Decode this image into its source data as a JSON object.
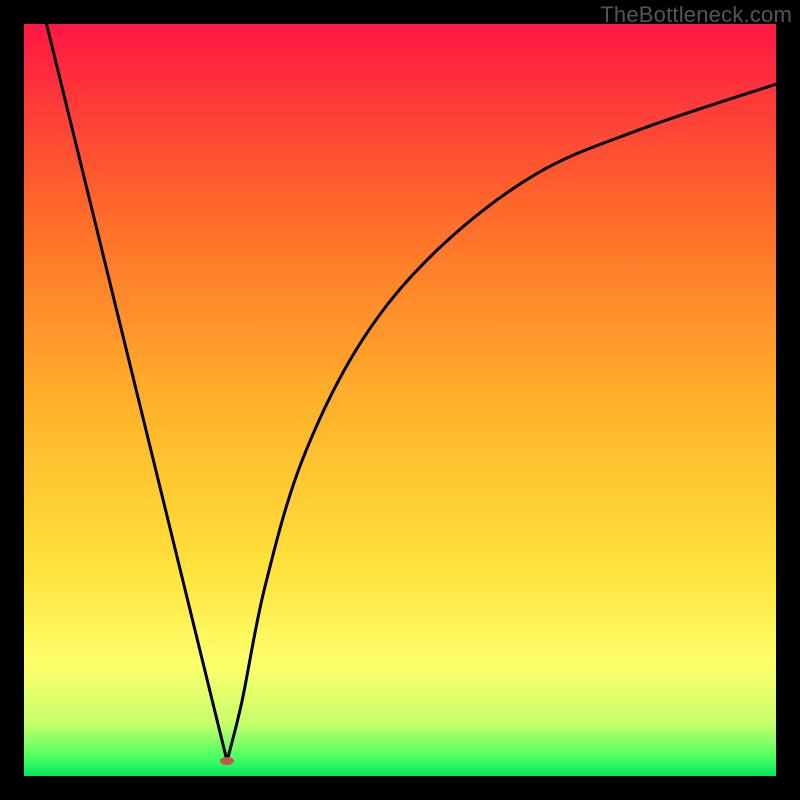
{
  "watermark": "TheBottleneck.com",
  "chart_data": {
    "type": "line",
    "title": "",
    "xlabel": "",
    "ylabel": "",
    "xlim": [
      0,
      100
    ],
    "ylim": [
      0,
      100
    ],
    "grid": false,
    "axes_visible": false,
    "gradient_stops": [
      {
        "offset": 0.0,
        "color": "#ff1744"
      },
      {
        "offset": 0.25,
        "color": "#ff6a2a"
      },
      {
        "offset": 0.5,
        "color": "#ffb02a"
      },
      {
        "offset": 0.72,
        "color": "#ffe23a"
      },
      {
        "offset": 0.85,
        "color": "#fdff6b"
      },
      {
        "offset": 0.93,
        "color": "#c8ff6b"
      },
      {
        "offset": 0.975,
        "color": "#4bff62"
      },
      {
        "offset": 1.0,
        "color": "#00e860"
      }
    ],
    "series": [
      {
        "name": "left-branch",
        "type": "line",
        "x": [
          3,
          27
        ],
        "y": [
          100,
          2
        ],
        "note": "straight descending segment from top-left edge to the cusp"
      },
      {
        "name": "right-branch",
        "type": "curve",
        "points": [
          {
            "x": 27,
            "y": 2
          },
          {
            "x": 29,
            "y": 10
          },
          {
            "x": 32,
            "y": 25
          },
          {
            "x": 37,
            "y": 42
          },
          {
            "x": 45,
            "y": 58
          },
          {
            "x": 55,
            "y": 70
          },
          {
            "x": 68,
            "y": 80
          },
          {
            "x": 82,
            "y": 86
          },
          {
            "x": 100,
            "y": 92
          }
        ],
        "note": "concave-down curve rising steeply from the cusp then flattening toward upper right"
      }
    ],
    "marker": {
      "name": "cusp-marker",
      "x": 27,
      "y": 2,
      "color": "#c1554d",
      "rx": 7,
      "ry": 4
    }
  }
}
